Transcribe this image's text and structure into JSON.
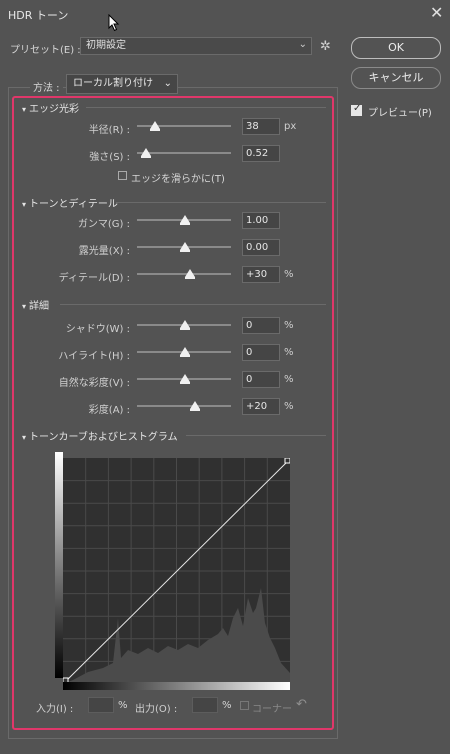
{
  "window": {
    "title": "HDR トーン"
  },
  "preset": {
    "label": "プリセット(E) :",
    "value": "初期設定"
  },
  "buttons": {
    "ok": "OK",
    "cancel": "キャンセル"
  },
  "preview": {
    "label": "プレビュー(P)",
    "checked": true
  },
  "method": {
    "label": "方法 :",
    "value": "ローカル割り付け"
  },
  "sections": {
    "edge": {
      "title": "エッジ光彩",
      "sliders": [
        {
          "label": "半径(R) :",
          "value": "38",
          "unit": "px",
          "level": 0.14
        },
        {
          "label": "強さ(S) :",
          "value": "0.52",
          "unit": "",
          "level": 0.09
        }
      ],
      "smooth_label": "エッジを滑らかに(T)",
      "smooth_checked": false
    },
    "tone": {
      "title": "トーンとディテール",
      "sliders": [
        {
          "label": "ガンマ(G) :",
          "value": "1.00",
          "unit": "",
          "level": 0.48
        },
        {
          "label": "露光量(X) :",
          "value": "0.00",
          "unit": "",
          "level": 0.48
        },
        {
          "label": "ディテール(D) :",
          "value": "+30",
          "unit": "%",
          "level": 0.54
        }
      ]
    },
    "detail": {
      "title": "詳細",
      "sliders": [
        {
          "label": "シャドウ(W) :",
          "value": "0",
          "unit": "%",
          "level": 0.48
        },
        {
          "label": "ハイライト(H) :",
          "value": "0",
          "unit": "%",
          "level": 0.48
        },
        {
          "label": "自然な彩度(V) :",
          "value": "0",
          "unit": "%",
          "level": 0.48
        },
        {
          "label": "彩度(A) :",
          "value": "+20",
          "unit": "%",
          "level": 0.6
        }
      ]
    },
    "curve": {
      "title": "トーンカーブおよびヒストグラム",
      "input_label": "入力(I) :",
      "output_label": "出力(O) :",
      "percent": "%",
      "corner_label": "コーナー"
    }
  },
  "colors": {
    "highlight": "#e0376a",
    "background": "#535353"
  }
}
